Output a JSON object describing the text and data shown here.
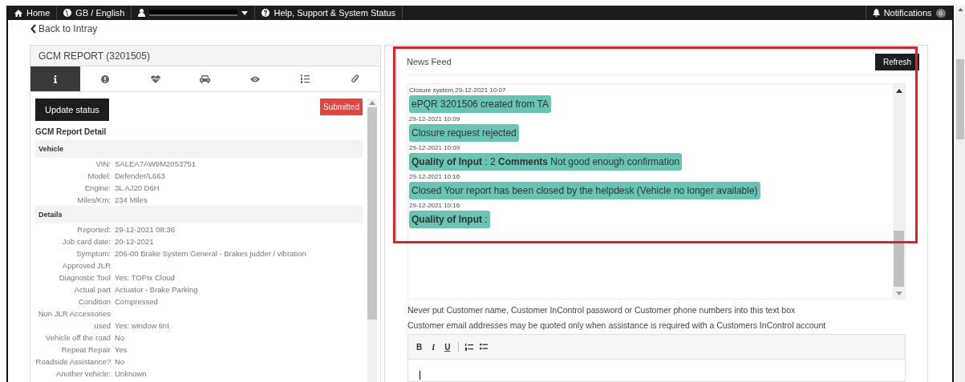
{
  "nav": {
    "items": [
      {
        "kind": "home",
        "label": "Home"
      },
      {
        "kind": "globe",
        "label": "GB / English"
      },
      {
        "kind": "user"
      },
      {
        "kind": "help",
        "label": "Help, Support & System Status"
      }
    ],
    "notifications": {
      "label": "Notifications",
      "count": "0"
    }
  },
  "back_link": "Back to Intray",
  "report": {
    "title": "GCM REPORT (3201505)",
    "tabs": [
      {
        "kind": "info",
        "selected": true
      },
      {
        "kind": "alert",
        "selected": false
      },
      {
        "kind": "heart",
        "selected": false
      },
      {
        "kind": "car",
        "selected": false
      },
      {
        "kind": "eye",
        "selected": false
      },
      {
        "kind": "list",
        "selected": false
      },
      {
        "kind": "clip",
        "selected": false
      }
    ],
    "update_button": "Update status",
    "status": "Submitted",
    "detail_title": "GCM Report Detail",
    "sections": [
      {
        "title": "Vehicle",
        "rows": [
          {
            "label": "VIN:",
            "value": "SALEA7AW9M2053751"
          },
          {
            "label": "Model:",
            "value": "Defender/L663"
          },
          {
            "label": "Engine:",
            "value": "3L AJ20 D6H"
          },
          {
            "label": "Miles/Km:",
            "value": "234 Miles"
          }
        ]
      },
      {
        "title": "Details",
        "rows": [
          {
            "label": "Reported:",
            "value": "29-12-2021 08:36"
          },
          {
            "label": "Job card date:",
            "value": "20-12-2021"
          },
          {
            "label": "Symptom:",
            "value": "206-00 Brake System General - Brakes judder / vibration"
          },
          {
            "label": "Approved JLR"
          },
          {
            "label": "Diagnostic Tool",
            "value": "Yes: TOPIx Cloud"
          },
          {
            "label": "Actual part",
            "value": "Actuator - Brake Parking"
          },
          {
            "label": "Condition",
            "value": "Compressed"
          },
          {
            "label": "Non JLR Accessories used",
            "value": "Yes: window tint"
          },
          {
            "label": "Vehicle off the road",
            "value": "No"
          },
          {
            "label": "Repeat Repair",
            "value": "Yes"
          },
          {
            "label": "Roadside Assistance?",
            "value": "No"
          },
          {
            "label": "Another vehicle:",
            "value": "Unknown"
          }
        ]
      }
    ]
  },
  "news_feed": {
    "title": "News Feed",
    "refresh_button": "Refresh",
    "messages": [
      {
        "meta": "Closure system 29-12-2021 10:07",
        "text": "ePQR 3201506 created from TA"
      },
      {
        "meta": "29-12-2021 10:09",
        "text": "Closure request rejected"
      },
      {
        "meta": "29-12-2021 10:09",
        "text": "**Quality of Input** : 2 **Comments** Not good enough confirmation"
      },
      {
        "meta": "29-12-2021 10:16",
        "text": "Closed Your report has been closed by the helpdesk (Vehicle no longer available)"
      },
      {
        "meta": "29-12-2021 10:16",
        "text": "**Quality of Input** :"
      }
    ]
  },
  "notices": [
    "Never put Customer name, Customer InControl password or Customer phone numbers into this text box",
    "Customer email addresses may be quoted only when assistance is required with a Customers InControl account"
  ],
  "editor": {
    "tools": [
      {
        "kind": "bold",
        "label": "B"
      },
      {
        "kind": "italic",
        "label": "I"
      },
      {
        "kind": "underline",
        "label": "U"
      },
      {
        "kind": "ordered"
      },
      {
        "kind": "bullets"
      }
    ]
  }
}
